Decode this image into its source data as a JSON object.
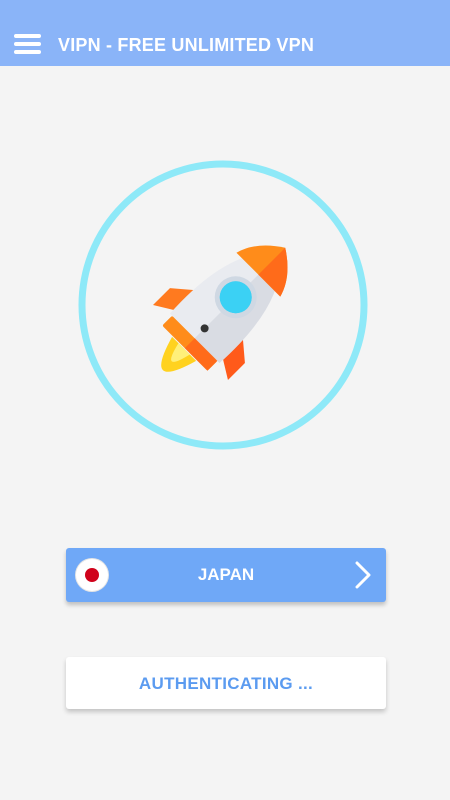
{
  "app": {
    "title": "VIPN - FREE UNLIMITED VPN",
    "menu_icon": "hamburger-menu-icon"
  },
  "connect": {
    "icon": "rocket-icon",
    "ring_color": "#8ee9f8"
  },
  "server": {
    "country": "JAPAN",
    "flag_icon": "japan-flag-icon",
    "chevron_icon": "chevron-right-icon",
    "bg_color": "#6fa8f7"
  },
  "status": {
    "text": "AUTHENTICATING ...",
    "text_color": "#5b9bf0"
  },
  "colors": {
    "appbar": "#8ab4f8",
    "background": "#f4f4f4"
  }
}
